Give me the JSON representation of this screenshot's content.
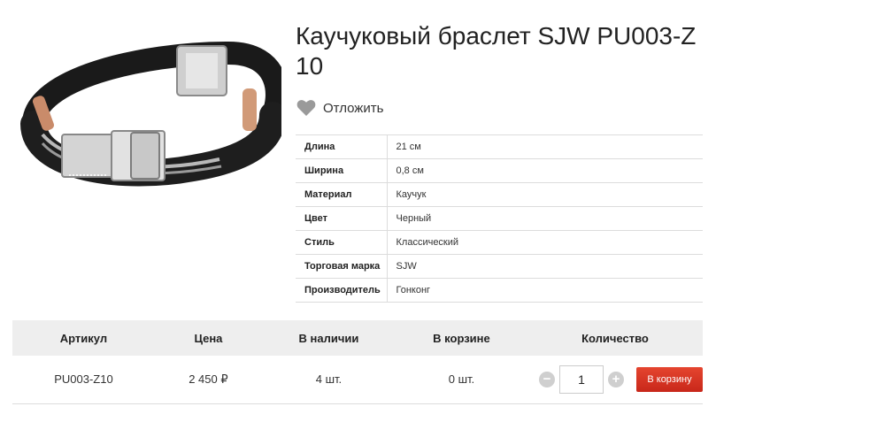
{
  "product": {
    "title": "Каучуковый браслет SJW PU003-Z10",
    "image_icon": "bracelet-photo"
  },
  "wishlist": {
    "label": "Отложить",
    "icon": "heart-icon"
  },
  "specs": [
    {
      "key": "Длина",
      "value": "21 см"
    },
    {
      "key": "Ширина",
      "value": "0,8 см"
    },
    {
      "key": "Материал",
      "value": "Каучук"
    },
    {
      "key": "Цвет",
      "value": "Черный"
    },
    {
      "key": "Стиль",
      "value": "Классический"
    },
    {
      "key": "Торговая марка",
      "value": "SJW"
    },
    {
      "key": "Производитель",
      "value": "Гонконг"
    }
  ],
  "offer": {
    "headers": {
      "sku": "Артикул",
      "price": "Цена",
      "stock": "В наличии",
      "in_cart": "В корзине",
      "quantity": "Количество"
    },
    "row": {
      "sku": "PU003-Z10",
      "price": "2 450 ₽",
      "stock": "4 шт.",
      "in_cart": "0 шт.",
      "quantity": "1",
      "minus": "−",
      "plus": "+",
      "add_to_cart": "В корзину"
    }
  },
  "colors": {
    "cart_button": "#d7301f",
    "heart": "#999999",
    "table_header_bg": "#eeeeee"
  }
}
